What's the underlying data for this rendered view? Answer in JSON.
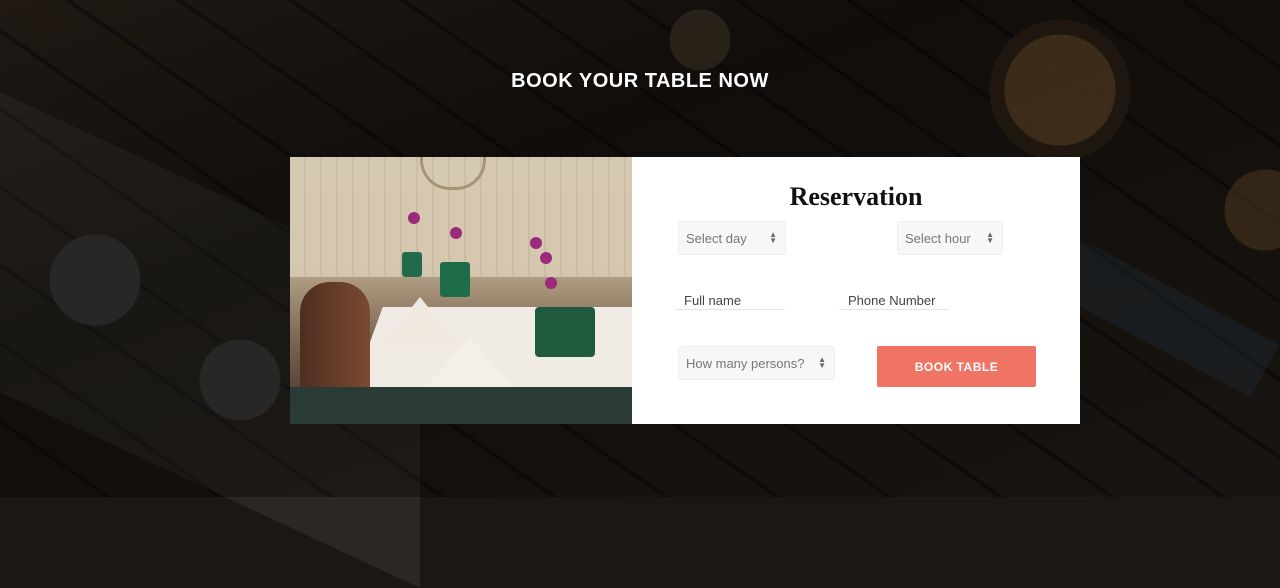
{
  "section": {
    "heading": "BOOK YOUR TABLE NOW"
  },
  "reservation": {
    "title": "Reservation",
    "day_select": {
      "value": "Select day"
    },
    "hour_select": {
      "value": "Select hour"
    },
    "full_name": {
      "placeholder": "Full name"
    },
    "phone": {
      "placeholder": "Phone Number"
    },
    "persons_select": {
      "value": "How many persons?"
    },
    "submit_label": "BOOK TABLE"
  },
  "icons": {
    "select_arrows": "sort-arrows-icon"
  },
  "colors": {
    "accent": "#f07463",
    "card_bg": "#ffffff",
    "heading_text": "#ffffff"
  }
}
